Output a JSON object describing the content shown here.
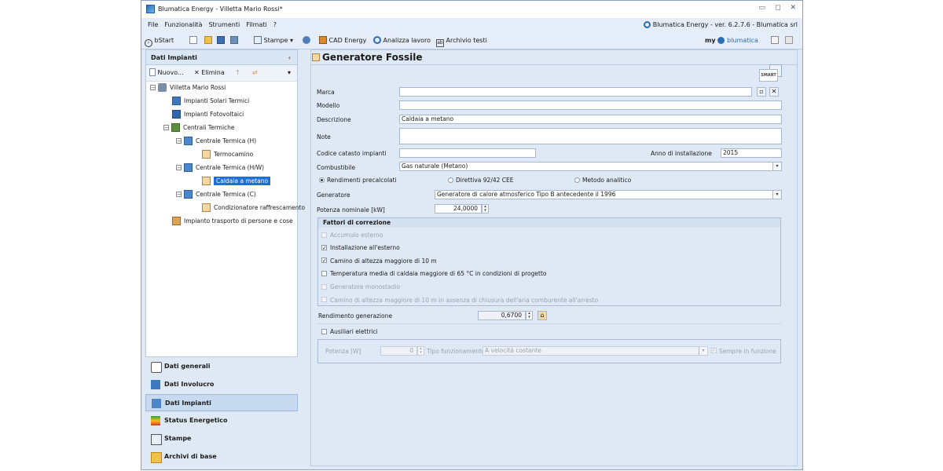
{
  "window": {
    "title": "Blumatica Energy - Villetta Mario Rossi*"
  },
  "menu": {
    "items": [
      "File",
      "Funzionalità",
      "Strumenti",
      "Filmati",
      "?"
    ],
    "version": "Blumatica Energy - ver. 6.2.7.6 - Blumatica srl"
  },
  "toolbar": {
    "bstart": "bStart",
    "stampe": "Stampe",
    "cad": "CAD Energy",
    "analizza": "Analizza lavoro",
    "archivio": "Archivio testi",
    "brand_my": "my",
    "brand_name": "blumatica"
  },
  "left": {
    "header": "Dati Impianti",
    "nuovo": "Nuovo...",
    "elimina": "Elimina",
    "tree": [
      "Villetta Mario Rossi",
      "Impianti Solari Termici",
      "Impianti Fotovoltaici",
      "Centrali Termiche",
      "Centrale Termica (H)",
      "Termocamino",
      "Centrale Termica (H/W)",
      "Caldaia a metano",
      "Centrale Termica (C)",
      "Condizionatore raffrescamento",
      "Impianto trasporto di persone e cose"
    ]
  },
  "nav": [
    "Dati generali",
    "Dati Involucro",
    "Dati Impianti",
    "Status Energetico",
    "Stampe",
    "Archivi di base"
  ],
  "main": {
    "title": "Generatore Fossile",
    "smart": "SMART",
    "labels": {
      "marca": "Marca",
      "modello": "Modello",
      "descrizione": "Descrizione",
      "note": "Note",
      "codice": "Codice catasto impianti",
      "anno": "Anno di installazione",
      "combustibile": "Combustibile",
      "generatore": "Generatore",
      "potenza": "Potenza nominale [kW]",
      "rendimento": "Rendimento generazione",
      "ausiliari": "Ausiliari elettrici",
      "potenza_w": "Potenza [W]",
      "tipo": "Tipo funzionamento",
      "sempre": "Sempre in funzione"
    },
    "values": {
      "marca": "",
      "modello": "",
      "descrizione": "Caldaia a metano",
      "note": "",
      "codice": "",
      "anno": "2015",
      "combustibile": "Gas naturale (Metano)",
      "generatore": "Generatore di calore atmosferico Tipo B antecedente il 1996",
      "potenza": "24,0000",
      "rendimento": "0,6700",
      "potenza_w": "0",
      "tipo": "A velocità costante"
    },
    "radios": [
      "Rendimenti precalcolati",
      "Direttiva 92/42 CEE",
      "Metodo analitico"
    ],
    "fattori": {
      "title": "Fattori di correzione",
      "items": [
        {
          "label": "Accumulo esterno",
          "checked": false,
          "enabled": false
        },
        {
          "label": "Installazione all'esterno",
          "checked": true,
          "enabled": true
        },
        {
          "label": "Camino di altezza maggiore di 10 m",
          "checked": true,
          "enabled": true
        },
        {
          "label": "Temperatura media di caldaia maggiore di 65 °C in condizioni di progetto",
          "checked": false,
          "enabled": true
        },
        {
          "label": "Generatore monostadio",
          "checked": false,
          "enabled": false
        },
        {
          "label": "Camino di altezza maggiore di 10 m in assenza di chiusura dell'aria comburente all'arresto",
          "checked": false,
          "enabled": false
        }
      ]
    }
  },
  "colors": {
    "selection": "#1f6fd6",
    "panel_bg": "#dfe9f5",
    "accent": "#2b6db3"
  }
}
